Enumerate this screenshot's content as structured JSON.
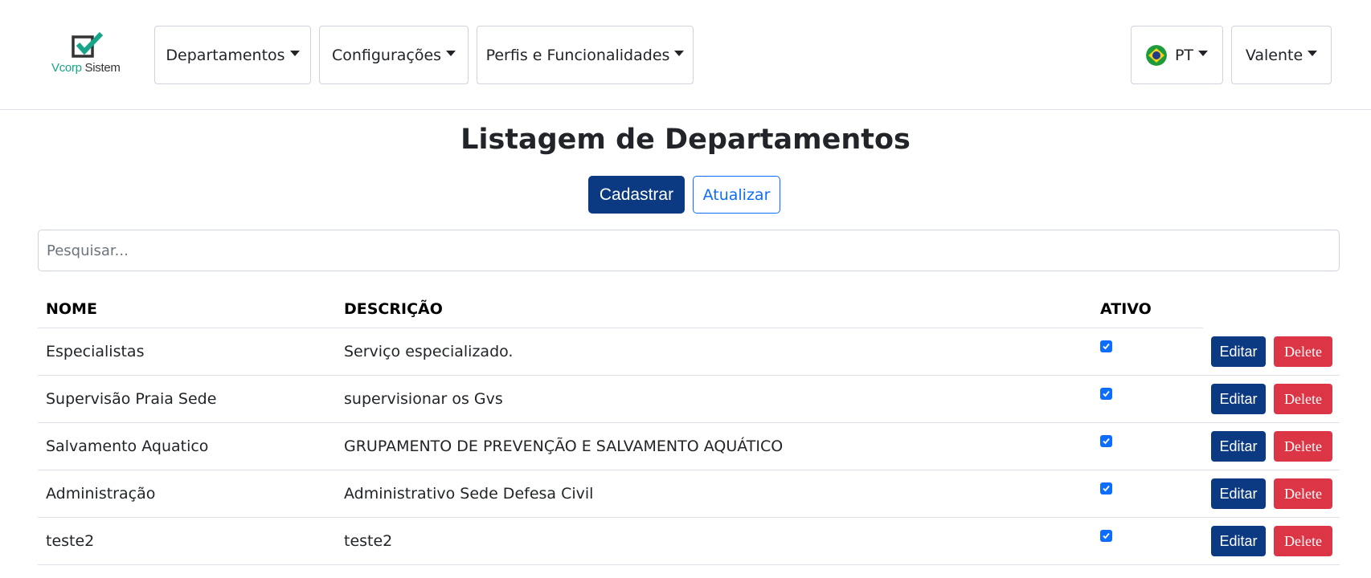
{
  "brand": {
    "name_part1": "Vcorp",
    "name_part2": " Sistem",
    "accent_color": "#17a589"
  },
  "nav": {
    "menus": [
      {
        "label": "Departamentos"
      },
      {
        "label": "Configurações"
      },
      {
        "label": "Perfis e Funcionalidades"
      }
    ],
    "language": {
      "label": "PT",
      "flag_icon": "brazil-flag-icon"
    },
    "user": {
      "label": "Valente"
    }
  },
  "page": {
    "title": "Listagem de Departamentos",
    "create_label": "Cadastrar",
    "refresh_label": "Atualizar",
    "search_placeholder": "Pesquisar..."
  },
  "table": {
    "columns": [
      "NOME",
      "DESCRIÇÃO",
      "ATIVO"
    ],
    "edit_label": "Editar",
    "delete_label": "Delete",
    "rows": [
      {
        "name": "Especialistas",
        "description": "Serviço especializado.",
        "active": true
      },
      {
        "name": "Supervisão Praia Sede",
        "description": "supervisionar os Gvs",
        "active": true
      },
      {
        "name": "Salvamento Aquatico",
        "description": "GRUPAMENTO DE PREVENÇÃO E SALVAMENTO AQUÁTICO",
        "active": true
      },
      {
        "name": "Administração",
        "description": "Administrativo Sede Defesa Civil",
        "active": true
      },
      {
        "name": "teste2",
        "description": "teste2",
        "active": true
      }
    ]
  },
  "colors": {
    "primary": "#0b3a82",
    "outline": "#0d6efd",
    "danger": "#dc3545"
  }
}
